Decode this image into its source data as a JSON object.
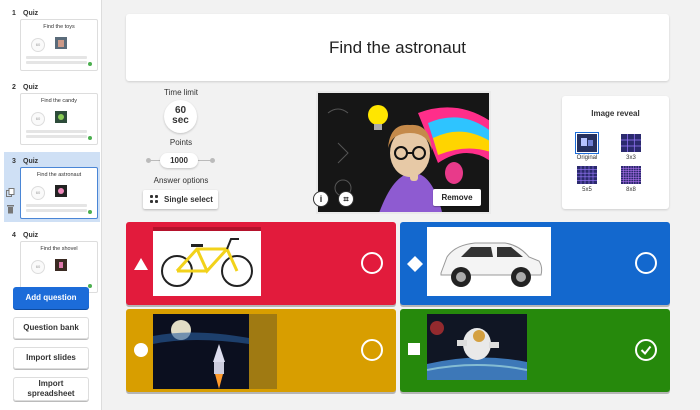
{
  "sidebar": {
    "slides": [
      {
        "num": "1",
        "type": "Quiz",
        "title": "Find the toys",
        "time": "60"
      },
      {
        "num": "2",
        "type": "Quiz",
        "title": "Find the candy",
        "time": "60"
      },
      {
        "num": "3",
        "type": "Quiz",
        "title": "Find the astronaut",
        "time": "60"
      },
      {
        "num": "4",
        "type": "Quiz",
        "title": "Find the shovel",
        "time": "60"
      }
    ],
    "add_question": "Add question",
    "question_bank": "Question bank",
    "import_slides": "Import slides",
    "import_spreadsheet_1": "Import",
    "import_spreadsheet_2": "spreadsheet",
    "icons": [
      "copy-icon",
      "trash-icon"
    ]
  },
  "question": {
    "title": "Find the astronaut"
  },
  "settings": {
    "time_limit_label": "Time limit",
    "time_value": "60",
    "time_unit": "sec",
    "points_label": "Points",
    "points_value": "1000",
    "answer_options_label": "Answer options",
    "answer_options_value": "Single select"
  },
  "media": {
    "remove_label": "Remove",
    "info_icon": "info-icon",
    "crop_icon": "crop-icon"
  },
  "image_reveal": {
    "title": "Image reveal",
    "options": [
      "Original",
      "3x3",
      "5x5",
      "8x8"
    ],
    "selected": "Original"
  },
  "answers": [
    {
      "shape": "triangle",
      "color": "#e21b3c",
      "image": "bicycle",
      "correct": false
    },
    {
      "shape": "diamond",
      "color": "#1368ce",
      "image": "car",
      "correct": false
    },
    {
      "shape": "circle",
      "color": "#d89e00",
      "image": "rocket",
      "correct": false
    },
    {
      "shape": "square",
      "color": "#26890c",
      "image": "astronaut",
      "correct": true
    }
  ]
}
